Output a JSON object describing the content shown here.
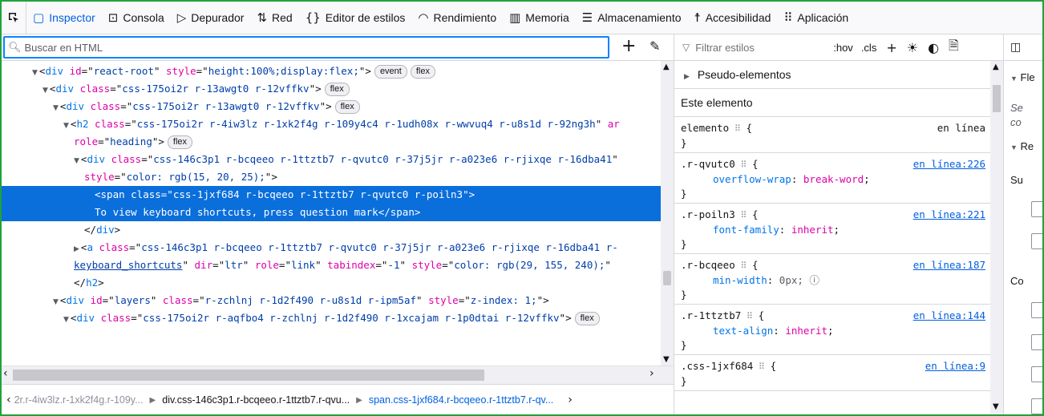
{
  "toolbar": {
    "tabs": [
      {
        "label": "Inspector",
        "icon": "inspector-icon",
        "glyph": "▢"
      },
      {
        "label": "Consola",
        "icon": "console-icon",
        "glyph": "⊡"
      },
      {
        "label": "Depurador",
        "icon": "debugger-icon",
        "glyph": "▷"
      },
      {
        "label": "Red",
        "icon": "network-icon",
        "glyph": "⇅"
      },
      {
        "label": "Editor de estilos",
        "icon": "style-editor-icon",
        "glyph": "{}"
      },
      {
        "label": "Rendimiento",
        "icon": "performance-icon",
        "glyph": "◠"
      },
      {
        "label": "Memoria",
        "icon": "memory-icon",
        "glyph": "▥"
      },
      {
        "label": "Almacenamiento",
        "icon": "storage-icon",
        "glyph": "☰"
      },
      {
        "label": "Accesibilidad",
        "icon": "accessibility-icon",
        "glyph": "☨"
      },
      {
        "label": "Aplicación",
        "icon": "application-icon",
        "glyph": "⠿"
      }
    ],
    "selected": "Inspector"
  },
  "markup": {
    "search_placeholder": "Buscar en HTML",
    "lines": [
      {
        "indent": 2,
        "tw": "▼",
        "parts": [
          [
            "p",
            "<"
          ],
          [
            "tg",
            "div"
          ],
          [
            "p",
            " "
          ],
          [
            "an",
            "id"
          ],
          [
            "p",
            "=\""
          ],
          [
            "av",
            "react-root"
          ],
          [
            "p",
            "\" "
          ],
          [
            "an",
            "style"
          ],
          [
            "p",
            "=\""
          ],
          [
            "av",
            "height:100%;display:flex;"
          ],
          [
            "p",
            "\">"
          ]
        ],
        "badges": [
          "event",
          "flex"
        ]
      },
      {
        "indent": 3,
        "tw": "▼",
        "parts": [
          [
            "p",
            "<"
          ],
          [
            "tg",
            "div"
          ],
          [
            "p",
            " "
          ],
          [
            "an",
            "class"
          ],
          [
            "p",
            "=\""
          ],
          [
            "av",
            "css-175oi2r r-13awgt0 r-12vffkv"
          ],
          [
            "p",
            "\">"
          ]
        ],
        "badges": [
          "flex"
        ]
      },
      {
        "indent": 4,
        "tw": "▼",
        "parts": [
          [
            "p",
            "<"
          ],
          [
            "tg",
            "div"
          ],
          [
            "p",
            " "
          ],
          [
            "an",
            "class"
          ],
          [
            "p",
            "=\""
          ],
          [
            "av",
            "css-175oi2r r-13awgt0 r-12vffkv"
          ],
          [
            "p",
            "\">"
          ]
        ],
        "badges": [
          "flex"
        ]
      },
      {
        "indent": 5,
        "tw": "▼",
        "parts": [
          [
            "p",
            "<"
          ],
          [
            "tg",
            "h2"
          ],
          [
            "p",
            " "
          ],
          [
            "an",
            "class"
          ],
          [
            "p",
            "=\""
          ],
          [
            "av",
            "css-175oi2r r-4iw3lz r-1xk2f4g r-109y4c4 r-1udh08x r-wwvuq4 r-u8s1d r-92ng3h"
          ],
          [
            "p",
            "\" "
          ],
          [
            "an",
            "ar"
          ]
        ],
        "badges": []
      },
      {
        "indent": 6,
        "tw": "",
        "parts": [
          [
            "an",
            "role"
          ],
          [
            "p",
            "=\""
          ],
          [
            "av",
            "heading"
          ],
          [
            "p",
            "\">"
          ]
        ],
        "badges": [
          "flex"
        ]
      },
      {
        "indent": 6,
        "tw": "▼",
        "parts": [
          [
            "p",
            "<"
          ],
          [
            "tg",
            "div"
          ],
          [
            "p",
            " "
          ],
          [
            "an",
            "class"
          ],
          [
            "p",
            "=\""
          ],
          [
            "av",
            "css-146c3p1 r-bcqeeo r-1ttztb7 r-qvutc0 r-37j5jr r-a023e6 r-rjixqe r-16dba41"
          ],
          [
            "p",
            "\""
          ]
        ],
        "badges": []
      },
      {
        "indent": 7,
        "tw": "",
        "parts": [
          [
            "an",
            "style"
          ],
          [
            "p",
            "=\""
          ],
          [
            "av",
            "color: rgb(15, 20, 25);"
          ],
          [
            "p",
            "\">"
          ]
        ],
        "badges": []
      },
      {
        "indent": 8,
        "tw": "",
        "sel": true,
        "parts": [
          [
            "p",
            "<span class=\"css-1jxf684 r-bcqeeo r-1ttztb7 r-qvutc0 r-poiln3\">"
          ]
        ],
        "badges": []
      },
      {
        "indent": 8,
        "tw": "",
        "sel": true,
        "parts": [
          [
            "p",
            "To view keyboard shortcuts, press question mark</span>"
          ]
        ],
        "badges": []
      },
      {
        "indent": 7,
        "tw": "",
        "parts": [
          [
            "p",
            "</"
          ],
          [
            "tg",
            "div"
          ],
          [
            "p",
            ">"
          ]
        ],
        "badges": []
      },
      {
        "indent": 6,
        "tw": "▶",
        "parts": [
          [
            "p",
            "<"
          ],
          [
            "tg",
            "a"
          ],
          [
            "p",
            " "
          ],
          [
            "an",
            "class"
          ],
          [
            "p",
            "=\""
          ],
          [
            "av",
            "css-146c3p1 r-bcqeeo r-1ttztb7 r-qvutc0 r-37j5jr r-a023e6 r-rjixqe r-16dba41 r-"
          ]
        ],
        "badges": []
      },
      {
        "indent": 6,
        "tw": "",
        "parts": [
          [
            "lk",
            "keyboard_shortcuts"
          ],
          [
            "p",
            "\" "
          ],
          [
            "an",
            "dir"
          ],
          [
            "p",
            "=\""
          ],
          [
            "av",
            "ltr"
          ],
          [
            "p",
            "\" "
          ],
          [
            "an",
            "role"
          ],
          [
            "p",
            "=\""
          ],
          [
            "av",
            "link"
          ],
          [
            "p",
            "\" "
          ],
          [
            "an",
            "tabindex"
          ],
          [
            "p",
            "=\""
          ],
          [
            "av",
            "-1"
          ],
          [
            "p",
            "\" "
          ],
          [
            "an",
            "style"
          ],
          [
            "p",
            "=\""
          ],
          [
            "av",
            "color: rgb(29, 155, 240);"
          ],
          [
            "p",
            "\""
          ]
        ],
        "badges": []
      },
      {
        "indent": 6,
        "tw": "",
        "parts": [
          [
            "p",
            "</"
          ],
          [
            "tg",
            "h2"
          ],
          [
            "p",
            ">"
          ]
        ],
        "badges": []
      },
      {
        "indent": 4,
        "tw": "▼",
        "parts": [
          [
            "p",
            "<"
          ],
          [
            "tg",
            "div"
          ],
          [
            "p",
            " "
          ],
          [
            "an",
            "id"
          ],
          [
            "p",
            "=\""
          ],
          [
            "av",
            "layers"
          ],
          [
            "p",
            "\" "
          ],
          [
            "an",
            "class"
          ],
          [
            "p",
            "=\""
          ],
          [
            "av",
            "r-zchlnj r-1d2f490 r-u8s1d r-ipm5af"
          ],
          [
            "p",
            "\" "
          ],
          [
            "an",
            "style"
          ],
          [
            "p",
            "=\""
          ],
          [
            "av",
            "z-index: 1;"
          ],
          [
            "p",
            "\">"
          ]
        ],
        "badges": []
      },
      {
        "indent": 5,
        "tw": "▼",
        "parts": [
          [
            "p",
            "<"
          ],
          [
            "tg",
            "div"
          ],
          [
            "p",
            " "
          ],
          [
            "an",
            "class"
          ],
          [
            "p",
            "=\""
          ],
          [
            "av",
            "css-175oi2r r-aqfbo4 r-zchlnj r-1d2f490 r-1xcajam r-1p0dtai r-12vffkv"
          ],
          [
            "p",
            "\">"
          ]
        ],
        "badges": [
          "flex"
        ]
      }
    ],
    "breadcrumbs": [
      {
        "text": "2r.r-4iw3lz.r-1xk2f4g.r-109y...",
        "state": "faded"
      },
      {
        "text": "div.css-146c3p1.r-bcqeeo.r-1ttztb7.r-qvu...",
        "state": "normal"
      },
      {
        "text": "span.css-1jxf684.r-bcqeeo.r-1ttztb7.r-qv...",
        "state": "current"
      }
    ]
  },
  "rules": {
    "filter_placeholder": "Filtrar estilos",
    "hov_label": ":hov",
    "cls_label": ".cls",
    "pseudo_label": "Pseudo-elementos",
    "this_element_label": "Este elemento",
    "items": [
      {
        "selector": "elemento",
        "source": "en línea",
        "link": false,
        "decls": []
      },
      {
        "selector": ".r-qvutc0",
        "source": "en línea:226",
        "link": true,
        "decls": [
          {
            "name": "overflow-wrap",
            "value": "break-word"
          }
        ]
      },
      {
        "selector": ".r-poiln3",
        "source": "en línea:221",
        "link": true,
        "decls": [
          {
            "name": "font-family",
            "value": "inherit"
          }
        ]
      },
      {
        "selector": ".r-bcqeeo",
        "source": "en línea:187",
        "link": true,
        "decls": [
          {
            "name": "min-width",
            "value": "0px;",
            "alt": true
          }
        ]
      },
      {
        "selector": ".r-1ttztb7",
        "source": "en línea:144",
        "link": true,
        "decls": [
          {
            "name": "text-align",
            "value": "inherit"
          }
        ]
      },
      {
        "selector": ".css-1jxf684",
        "source": "en línea:9",
        "link": true,
        "decls": []
      }
    ]
  },
  "side": {
    "sections": [
      "Fle",
      "Se",
      "co",
      "Re",
      "Su",
      "Co"
    ]
  }
}
